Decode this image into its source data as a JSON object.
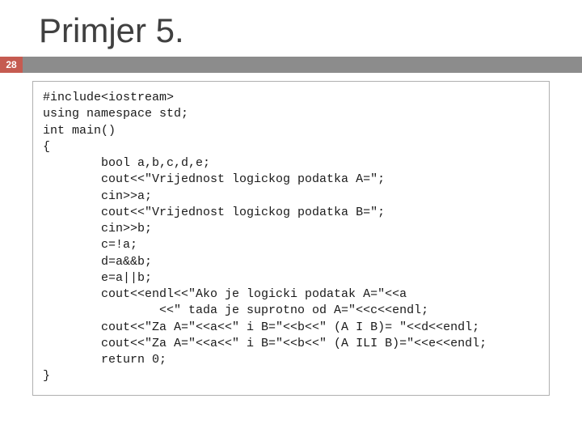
{
  "title": "Primjer 5.",
  "slide_number": "28",
  "code": "#include<iostream>\nusing namespace std;\nint main()\n{\n        bool a,b,c,d,e;\n        cout<<\"Vrijednost logickog podatka A=\";\n        cin>>a;\n        cout<<\"Vrijednost logickog podatka B=\";\n        cin>>b;\n        c=!a;\n        d=a&&b;\n        e=a||b;\n        cout<<endl<<\"Ako je logicki podatak A=\"<<a\n                <<\" tada je suprotno od A=\"<<c<<endl;\n        cout<<\"Za A=\"<<a<<\" i B=\"<<b<<\" (A I B)= \"<<d<<endl;\n        cout<<\"Za A=\"<<a<<\" i B=\"<<b<<\" (A ILI B)=\"<<e<<endl;\n        return 0;\n}"
}
